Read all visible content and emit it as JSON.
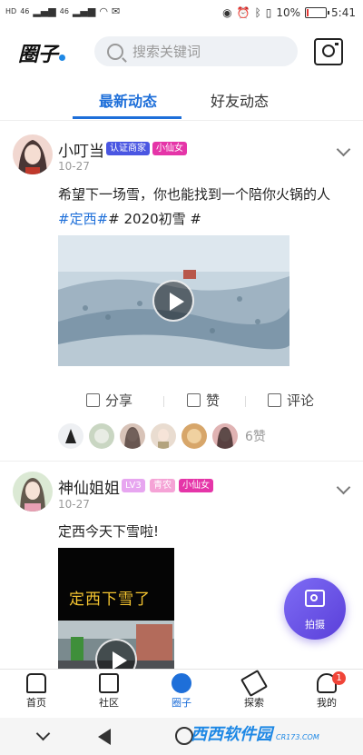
{
  "status_bar": {
    "left_labels": [
      "HD",
      "46",
      "46",
      "HD"
    ],
    "battery_percent": "10%",
    "battery_level": 0.1,
    "time": "5:41"
  },
  "header": {
    "logo_text": "圈子",
    "search_placeholder": "搜索关键词"
  },
  "tabs": [
    {
      "label": "最新动态",
      "active": true
    },
    {
      "label": "好友动态",
      "active": false
    }
  ],
  "posts": [
    {
      "username": "小叮当",
      "badges": [
        {
          "label": "认证商家",
          "color": "#4a56e2"
        },
        {
          "label": "小仙女",
          "color": "#e535a8"
        }
      ],
      "date": "10-27",
      "text": "希望下一场雪，你也能找到一个陪你火锅的人",
      "hashtags": [
        "#定西#",
        "# 2020初雪 #"
      ],
      "actions": {
        "share": "分享",
        "like": "赞",
        "comment": "评论"
      },
      "like_count": "6赞"
    },
    {
      "username": "神仙姐姐",
      "badges": [
        {
          "label": "LV3",
          "color": "#e7a6f0"
        },
        {
          "label": "青农",
          "color": "#f5a3d6"
        },
        {
          "label": "小仙女",
          "color": "#e535a8"
        }
      ],
      "date": "10-27",
      "text": "定西今天下雪啦!",
      "media_caption": "定西下雪了"
    }
  ],
  "fab": {
    "label": "拍摄"
  },
  "bottom_nav": [
    {
      "label": "首页",
      "icon": "home-icon",
      "active": false
    },
    {
      "label": "社区",
      "icon": "calendar-icon",
      "active": false
    },
    {
      "label": "圈子",
      "icon": "circle-icon",
      "active": true
    },
    {
      "label": "探索",
      "icon": "telescope-icon",
      "active": false
    },
    {
      "label": "我的",
      "icon": "user-icon",
      "active": false,
      "badge": "1"
    }
  ],
  "watermark": {
    "text": "西西软件园",
    "sub": "CR173.COM"
  },
  "colors": {
    "accent": "#1e6fd9",
    "fab": "#6a52e6",
    "badge_red": "#f04438"
  }
}
